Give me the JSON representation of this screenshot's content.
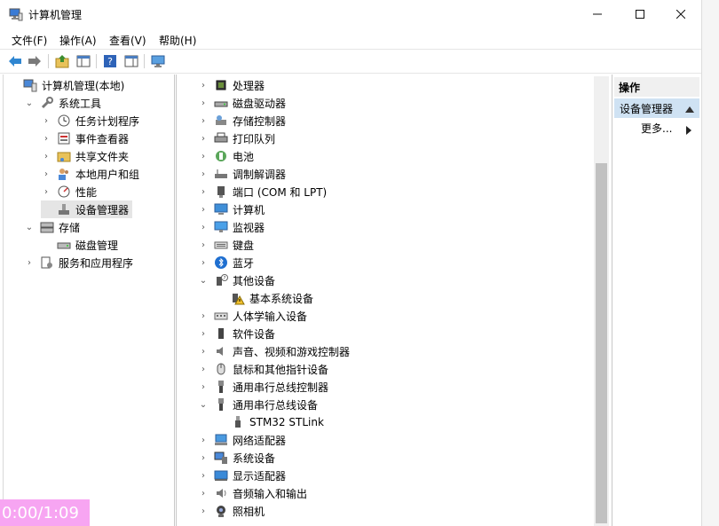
{
  "window": {
    "title": "计算机管理"
  },
  "menu": [
    "文件(F)",
    "操作(A)",
    "查看(V)",
    "帮助(H)"
  ],
  "tree": [
    {
      "label": "计算机管理(本地)",
      "chev": "",
      "indent": 0,
      "icon": "computer-management-icon"
    },
    {
      "label": "系统工具",
      "chev": "⌄",
      "indent": 1,
      "icon": "system-tools-icon"
    },
    {
      "label": "任务计划程序",
      "chev": "›",
      "indent": 2,
      "icon": "task-scheduler-icon"
    },
    {
      "label": "事件查看器",
      "chev": "›",
      "indent": 2,
      "icon": "event-viewer-icon"
    },
    {
      "label": "共享文件夹",
      "chev": "›",
      "indent": 2,
      "icon": "shared-folders-icon"
    },
    {
      "label": "本地用户和组",
      "chev": "›",
      "indent": 2,
      "icon": "local-users-icon"
    },
    {
      "label": "性能",
      "chev": "›",
      "indent": 2,
      "icon": "performance-icon"
    },
    {
      "label": "设备管理器",
      "chev": "",
      "indent": 2,
      "icon": "device-manager-icon",
      "selected": true
    },
    {
      "label": "存储",
      "chev": "⌄",
      "indent": 1,
      "icon": "storage-icon"
    },
    {
      "label": "磁盘管理",
      "chev": "",
      "indent": 2,
      "icon": "disk-management-icon"
    },
    {
      "label": "服务和应用程序",
      "chev": "›",
      "indent": 1,
      "icon": "services-icon"
    }
  ],
  "devices": [
    {
      "label": "处理器",
      "chev": "›",
      "indent": 0,
      "icon": "processor-icon"
    },
    {
      "label": "磁盘驱动器",
      "chev": "›",
      "indent": 0,
      "icon": "disk-drive-icon"
    },
    {
      "label": "存储控制器",
      "chev": "›",
      "indent": 0,
      "icon": "storage-controller-icon"
    },
    {
      "label": "打印队列",
      "chev": "›",
      "indent": 0,
      "icon": "printer-icon"
    },
    {
      "label": "电池",
      "chev": "›",
      "indent": 0,
      "icon": "battery-icon"
    },
    {
      "label": "调制解调器",
      "chev": "›",
      "indent": 0,
      "icon": "modem-icon"
    },
    {
      "label": "端口 (COM 和 LPT)",
      "chev": "›",
      "indent": 0,
      "icon": "port-icon"
    },
    {
      "label": "计算机",
      "chev": "›",
      "indent": 0,
      "icon": "computer-icon"
    },
    {
      "label": "监视器",
      "chev": "›",
      "indent": 0,
      "icon": "monitor-icon"
    },
    {
      "label": "键盘",
      "chev": "›",
      "indent": 0,
      "icon": "keyboard-icon"
    },
    {
      "label": "蓝牙",
      "chev": "›",
      "indent": 0,
      "icon": "bluetooth-icon"
    },
    {
      "label": "其他设备",
      "chev": "⌄",
      "indent": 0,
      "icon": "unknown-device-icon"
    },
    {
      "label": "基本系统设备",
      "chev": "",
      "indent": 1,
      "icon": "warning-device-icon"
    },
    {
      "label": "人体学输入设备",
      "chev": "›",
      "indent": 0,
      "icon": "hid-icon"
    },
    {
      "label": "软件设备",
      "chev": "›",
      "indent": 0,
      "icon": "software-device-icon"
    },
    {
      "label": "声音、视频和游戏控制器",
      "chev": "›",
      "indent": 0,
      "icon": "sound-icon"
    },
    {
      "label": "鼠标和其他指针设备",
      "chev": "›",
      "indent": 0,
      "icon": "mouse-icon"
    },
    {
      "label": "通用串行总线控制器",
      "chev": "›",
      "indent": 0,
      "icon": "usb-controller-icon"
    },
    {
      "label": "通用串行总线设备",
      "chev": "⌄",
      "indent": 0,
      "icon": "usb-device-icon"
    },
    {
      "label": "STM32 STLink",
      "chev": "",
      "indent": 1,
      "icon": "usb-plug-icon"
    },
    {
      "label": "网络适配器",
      "chev": "›",
      "indent": 0,
      "icon": "network-adapter-icon"
    },
    {
      "label": "系统设备",
      "chev": "›",
      "indent": 0,
      "icon": "system-device-icon"
    },
    {
      "label": "显示适配器",
      "chev": "›",
      "indent": 0,
      "icon": "display-adapter-icon"
    },
    {
      "label": "音频输入和输出",
      "chev": "›",
      "indent": 0,
      "icon": "audio-io-icon"
    },
    {
      "label": "照相机",
      "chev": "›",
      "indent": 0,
      "icon": "camera-icon"
    }
  ],
  "actions": {
    "header": "操作",
    "section": "设备管理器",
    "more": "更多..."
  },
  "timer": "0:00/1:09",
  "colors": {
    "selection": "#e5e5e5",
    "actions_section": "#cfe2f3",
    "timer_bg": "#f7a5f2"
  }
}
